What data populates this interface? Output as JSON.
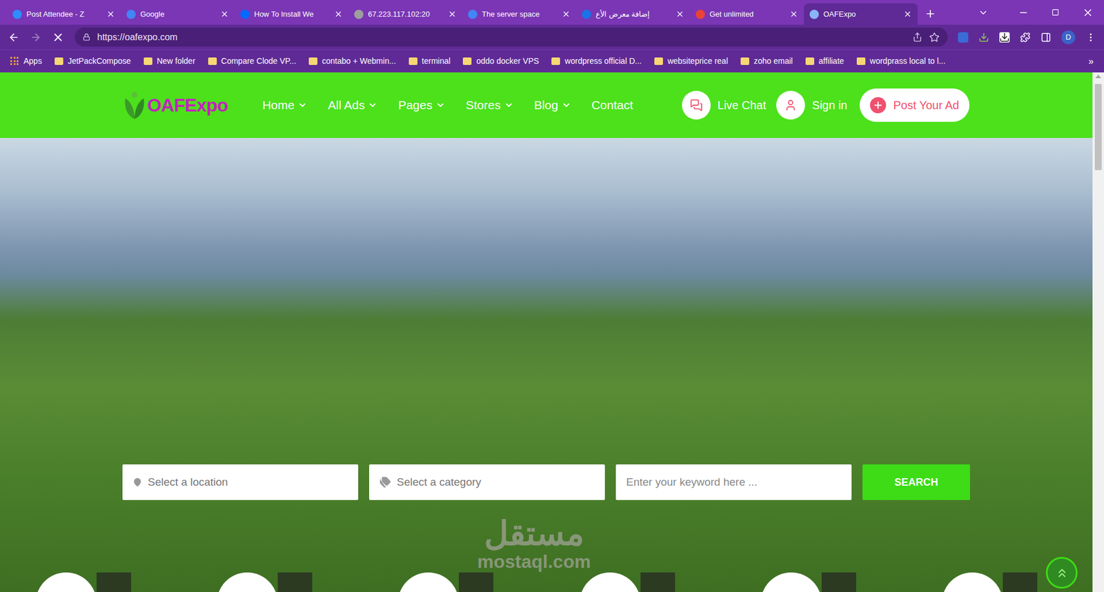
{
  "browser": {
    "tabs": [
      {
        "label": "Post Attendee - Z",
        "selected": false,
        "color": "#2d8cff"
      },
      {
        "label": "Google",
        "selected": false,
        "color": "#4285f4"
      },
      {
        "label": "How To Install We",
        "selected": false,
        "color": "#0069ff"
      },
      {
        "label": "67.223.117.102:20",
        "selected": false,
        "color": "#9e9e9e"
      },
      {
        "label": "The server space",
        "selected": false,
        "color": "#4285f4"
      },
      {
        "label": "إضافة معرض الأع",
        "selected": false,
        "color": "#1a73e8"
      },
      {
        "label": "Get unlimited",
        "selected": false,
        "color": "#ea4335"
      },
      {
        "label": "OAFExpo",
        "selected": true,
        "color": "#8ab4f8"
      }
    ],
    "url": "https://oafexpo.com",
    "loading": true,
    "forward_enabled": false,
    "profile": "D",
    "bookmarks": [
      "Apps",
      "JetPackCompose",
      "New folder",
      "Compare Clode VP...",
      "contabo + Webmin...",
      "terminal",
      "oddo docker VPS",
      "wordpress official D...",
      "websiteprice real",
      "zoho email",
      "affiliate",
      "wordprass local to l..."
    ],
    "bookmarks_more": "»"
  },
  "site": {
    "logo": "OAFExpo",
    "nav": [
      {
        "label": "Home",
        "has_menu": true
      },
      {
        "label": "All Ads",
        "has_menu": true
      },
      {
        "label": "Pages",
        "has_menu": true
      },
      {
        "label": "Stores",
        "has_menu": true
      },
      {
        "label": "Blog",
        "has_menu": true
      },
      {
        "label": "Contact",
        "has_menu": false
      }
    ],
    "live_chat": "Live Chat",
    "sign_in": "Sign in",
    "post_ad": "Post Your Ad",
    "search": {
      "location": "Select a location",
      "category": "Select a category",
      "keyword": "Enter your keyword here ...",
      "button": "SEARCH"
    },
    "category_cards": 6
  },
  "watermark": [
    "مستقل",
    "mostaql.com"
  ]
}
